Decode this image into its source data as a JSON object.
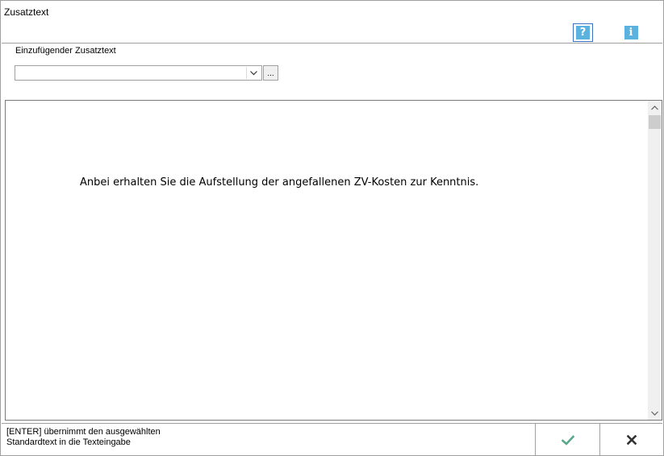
{
  "window": {
    "title": "Zusatztext"
  },
  "toolbar": {
    "help_icon": "help-icon",
    "info_icon": "info-icon",
    "help_glyph": "?",
    "info_glyph": "i"
  },
  "field": {
    "label": "Einzufügender Zusatztext",
    "value": "",
    "browse_label": "..."
  },
  "editor": {
    "text": "Anbei erhalten Sie die Aufstellung der angefallenen ZV-Kosten zur Kenntnis."
  },
  "footer": {
    "hint_line1": "[ENTER] übernimmt den ausgewählten",
    "hint_line2": "Standardtext in die Texteingabe"
  },
  "colors": {
    "accent": "#5bb2df",
    "ok": "#5aa88a",
    "cancel": "#333333"
  }
}
